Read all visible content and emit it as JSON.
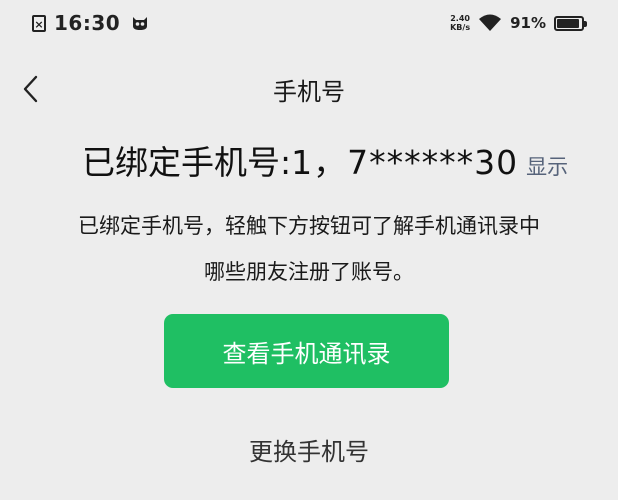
{
  "status_bar": {
    "time": "16:30",
    "sim_icon": "sim-card-x-icon",
    "notification_icon": "app-face-icon",
    "net_speed_value": "2.40",
    "net_speed_unit": "KB/s",
    "wifi_icon": "wifi-icon",
    "battery_percent": "91%",
    "battery_level": 0.91
  },
  "nav": {
    "back_icon": "chevron-left-icon",
    "title": "手机号"
  },
  "phone": {
    "label": "已绑定手机号: ",
    "number": "1，7******30",
    "show_label": "显示"
  },
  "description": {
    "line1": "已绑定手机号，轻触下方按钮可了解手机通讯录中",
    "line2": "哪些朋友注册了账号。"
  },
  "actions": {
    "view_contacts_label": "查看手机通讯录",
    "change_phone_label": "更换手机号"
  },
  "colors": {
    "accent": "#1fbf63",
    "background": "#ededed",
    "link": "#56637a"
  }
}
